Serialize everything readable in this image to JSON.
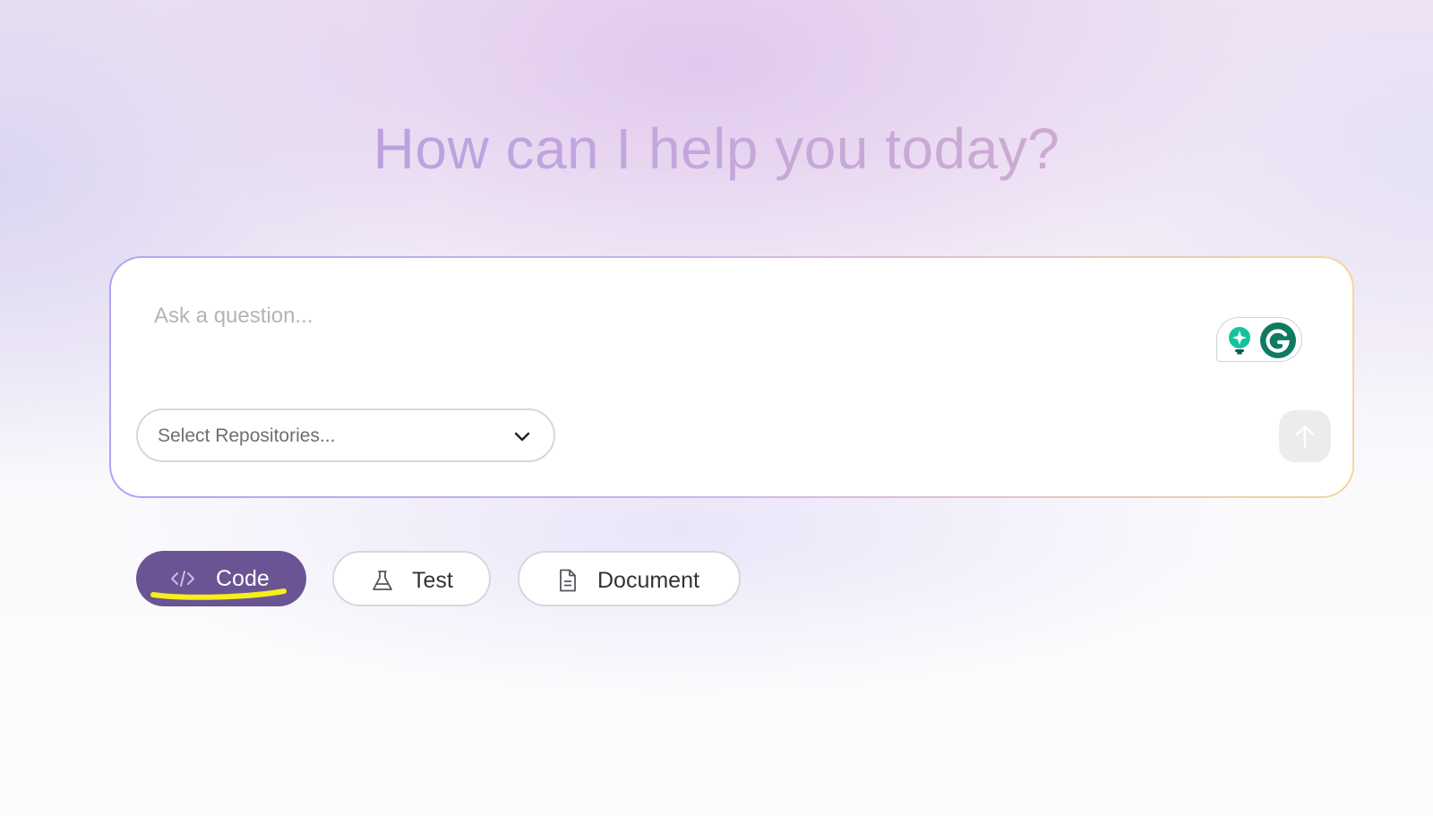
{
  "heading": "How can I help you today?",
  "composer": {
    "placeholder": "Ask a question...",
    "repo_select": {
      "label": "Select Repositories...",
      "icon": "chevron-down-icon"
    },
    "send_icon": "arrow-up-icon",
    "extension_icons": [
      "grammarly-suggestion-icon",
      "grammarly-logo-icon"
    ]
  },
  "chips": [
    {
      "label": "Code",
      "icon": "code-icon",
      "selected": true
    },
    {
      "label": "Test",
      "icon": "flask-icon",
      "selected": false
    },
    {
      "label": "Document",
      "icon": "document-icon",
      "selected": false
    }
  ],
  "colors": {
    "selected_chip": "#6b5493",
    "highlight": "#f5ef1a",
    "grammarly_green": "#0f7a62",
    "grammarly_teal": "#15c39a"
  }
}
